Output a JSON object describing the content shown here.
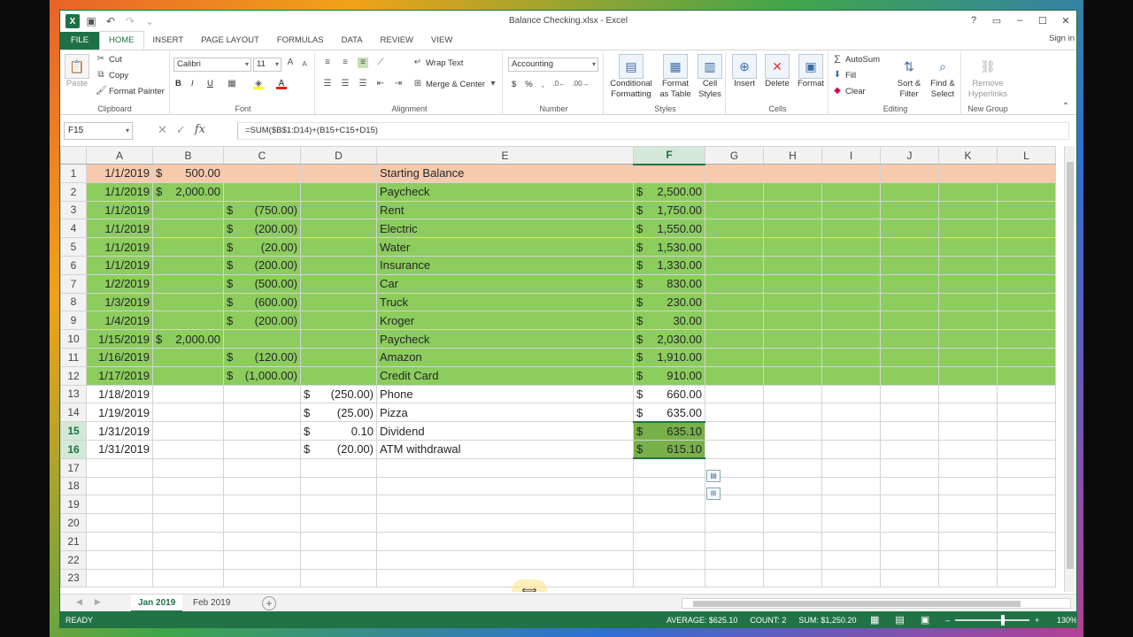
{
  "window": {
    "title": "Balance Checking.xlsx - Excel"
  },
  "title_controls": [
    "?",
    "▭",
    "–",
    "☐",
    "✕"
  ],
  "ribbon_tabs": [
    "FILE",
    "HOME",
    "INSERT",
    "PAGE LAYOUT",
    "FORMULAS",
    "DATA",
    "REVIEW",
    "VIEW"
  ],
  "signin": "Sign in",
  "ribbon": {
    "clipboard": {
      "label": "Clipboard",
      "paste": "Paste",
      "cut": "Cut",
      "copy": "Copy",
      "format_painter": "Format Painter"
    },
    "font": {
      "label": "Font",
      "name": "Calibri",
      "size": "11",
      "bold": "B",
      "italic": "I",
      "underline": "U"
    },
    "alignment": {
      "label": "Alignment",
      "wrap": "Wrap Text",
      "merge": "Merge & Center"
    },
    "number": {
      "label": "Number",
      "format": "Accounting",
      "currency": "$",
      "percent": "%",
      "comma": ","
    },
    "styles": {
      "label": "Styles",
      "conditional": "Conditional Formatting",
      "format_table": "Format as Table",
      "cell_styles": "Cell Styles"
    },
    "cells": {
      "label": "Cells",
      "insert": "Insert",
      "delete": "Delete",
      "format": "Format"
    },
    "editing": {
      "label": "Editing",
      "autosum": "AutoSum",
      "fill": "Fill",
      "clear": "Clear",
      "sort": "Sort & Filter",
      "find": "Find & Select"
    },
    "newgroup": {
      "label": "New Group",
      "remove": "Remove Hyperlinks"
    }
  },
  "formula_bar": {
    "name_box": "F15",
    "formula": "=SUM($B$1:D14)+(B15+C15+D15)"
  },
  "columns": [
    "A",
    "B",
    "C",
    "D",
    "E",
    "F",
    "G",
    "H",
    "I",
    "J",
    "K",
    "L"
  ],
  "rows": [
    {
      "n": "1",
      "A": "1/1/2019",
      "B": [
        "$",
        "500.00"
      ],
      "C": null,
      "D": null,
      "E": "Starting Balance",
      "F": null,
      "fill": "peach"
    },
    {
      "n": "2",
      "A": "1/1/2019",
      "B": [
        "$",
        "2,000.00"
      ],
      "C": null,
      "D": null,
      "E": "Paycheck",
      "F": [
        "$",
        "2,500.00"
      ],
      "fill": "green"
    },
    {
      "n": "3",
      "A": "1/1/2019",
      "B": null,
      "C": [
        "$",
        "(750.00)"
      ],
      "D": null,
      "E": "Rent",
      "F": [
        "$",
        "1,750.00"
      ],
      "fill": "green"
    },
    {
      "n": "4",
      "A": "1/1/2019",
      "B": null,
      "C": [
        "$",
        "(200.00)"
      ],
      "D": null,
      "E": "Electric",
      "F": [
        "$",
        "1,550.00"
      ],
      "fill": "green"
    },
    {
      "n": "5",
      "A": "1/1/2019",
      "B": null,
      "C": [
        "$",
        "(20.00)"
      ],
      "D": null,
      "E": "Water",
      "F": [
        "$",
        "1,530.00"
      ],
      "fill": "green"
    },
    {
      "n": "6",
      "A": "1/1/2019",
      "B": null,
      "C": [
        "$",
        "(200.00)"
      ],
      "D": null,
      "E": "Insurance",
      "F": [
        "$",
        "1,330.00"
      ],
      "fill": "green"
    },
    {
      "n": "7",
      "A": "1/2/2019",
      "B": null,
      "C": [
        "$",
        "(500.00)"
      ],
      "D": null,
      "E": "Car",
      "F": [
        "$",
        "830.00"
      ],
      "fill": "green"
    },
    {
      "n": "8",
      "A": "1/3/2019",
      "B": null,
      "C": [
        "$",
        "(600.00)"
      ],
      "D": null,
      "E": "Truck",
      "F": [
        "$",
        "230.00"
      ],
      "fill": "green"
    },
    {
      "n": "9",
      "A": "1/4/2019",
      "B": null,
      "C": [
        "$",
        "(200.00)"
      ],
      "D": null,
      "E": "Kroger",
      "F": [
        "$",
        "30.00"
      ],
      "fill": "green"
    },
    {
      "n": "10",
      "A": "1/15/2019",
      "B": [
        "$",
        "2,000.00"
      ],
      "C": null,
      "D": null,
      "E": "Paycheck",
      "F": [
        "$",
        "2,030.00"
      ],
      "fill": "green"
    },
    {
      "n": "11",
      "A": "1/16/2019",
      "B": null,
      "C": [
        "$",
        "(120.00)"
      ],
      "D": null,
      "E": "Amazon",
      "F": [
        "$",
        "1,910.00"
      ],
      "fill": "green"
    },
    {
      "n": "12",
      "A": "1/17/2019",
      "B": null,
      "C": [
        "$",
        "(1,000.00)"
      ],
      "D": null,
      "E": "Credit Card",
      "F": [
        "$",
        "910.00"
      ],
      "fill": "green"
    },
    {
      "n": "13",
      "A": "1/18/2019",
      "B": null,
      "C": null,
      "D": [
        "$",
        "(250.00)"
      ],
      "E": "Phone",
      "F": [
        "$",
        "660.00"
      ],
      "fill": "none"
    },
    {
      "n": "14",
      "A": "1/19/2019",
      "B": null,
      "C": null,
      "D": [
        "$",
        "(25.00)"
      ],
      "E": "Pizza",
      "F": [
        "$",
        "635.00"
      ],
      "fill": "none"
    },
    {
      "n": "15",
      "A": "1/31/2019",
      "B": null,
      "C": null,
      "D": [
        "$",
        "0.10"
      ],
      "E": "Dividend",
      "F": [
        "$",
        "635.10"
      ],
      "fill": "none",
      "selected": true
    },
    {
      "n": "16",
      "A": "1/31/2019",
      "B": null,
      "C": null,
      "D": [
        "$",
        "(20.00)"
      ],
      "E": "ATM withdrawal",
      "F": [
        "$",
        "615.10"
      ],
      "fill": "none",
      "selected": true
    },
    {
      "n": "17"
    },
    {
      "n": "18"
    },
    {
      "n": "19"
    },
    {
      "n": "20"
    },
    {
      "n": "21"
    },
    {
      "n": "22"
    },
    {
      "n": "23"
    }
  ],
  "sheet_tabs": [
    "Jan 2019",
    "Feb 2019"
  ],
  "status": {
    "ready": "READY",
    "average": "AVERAGE: $625.10",
    "count": "COUNT: 2",
    "sum": "SUM: $1,250.20",
    "zoom": "130%"
  },
  "colors": {
    "excel_green": "#217346",
    "peach": "#f7caac",
    "row_green": "#8ccd5e"
  }
}
